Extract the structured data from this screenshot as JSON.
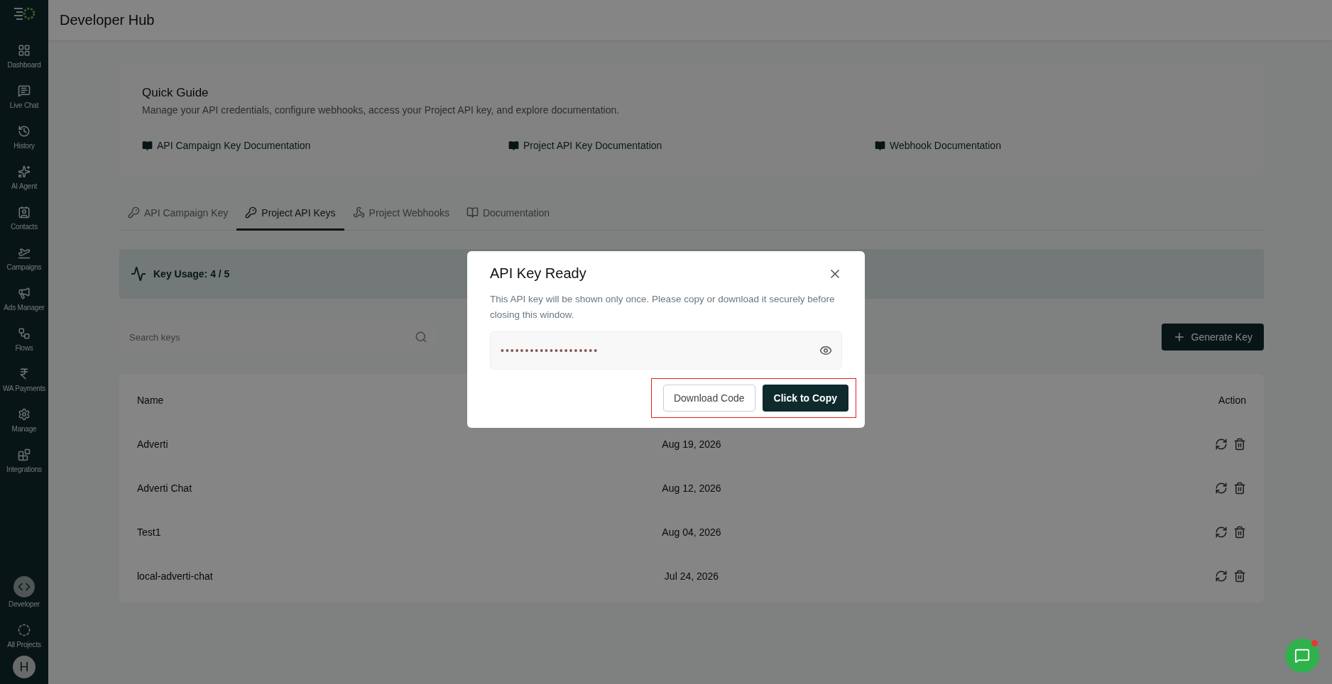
{
  "sidebar": {
    "items": [
      {
        "label": "Dashboard",
        "selected": false
      },
      {
        "label": "Live Chat",
        "selected": false
      },
      {
        "label": "History",
        "selected": false
      },
      {
        "label": "AI Agent",
        "selected": false
      },
      {
        "label": "Contacts",
        "selected": false
      },
      {
        "label": "Campaigns",
        "selected": false
      },
      {
        "label": "Ads Manager",
        "selected": false
      },
      {
        "label": "Flows",
        "selected": false
      },
      {
        "label": "WA Payments",
        "selected": false
      },
      {
        "label": "Manage",
        "selected": false
      },
      {
        "label": "Integrations",
        "selected": false
      }
    ],
    "bottom_items": [
      {
        "label": "Developer",
        "selected": true
      },
      {
        "label": "All Projects",
        "selected": false
      }
    ],
    "avatar": "H"
  },
  "header": {
    "title": "Developer Hub"
  },
  "quick_guide": {
    "title": "Quick Guide",
    "description": "Manage your API credentials, configure webhooks, access your Project API key, and explore documentation.",
    "links": [
      "API Campaign Key Documentation",
      "Project API Key Documentation",
      "Webhook Documentation"
    ]
  },
  "tabs": [
    {
      "label": "API Campaign Key",
      "selected": false
    },
    {
      "label": "Project API Keys",
      "selected": true
    },
    {
      "label": "Project Webhooks",
      "selected": false
    },
    {
      "label": "Documentation",
      "selected": false
    }
  ],
  "usage": {
    "label": "Key Usage: 4 / 5"
  },
  "search": {
    "placeholder": "Search keys"
  },
  "generate_button": "Generate Key",
  "table": {
    "columns": [
      "Name",
      "Action"
    ],
    "rows": [
      {
        "name": "Adverti",
        "date": "Aug 19, 2026"
      },
      {
        "name": "Adverti Chat",
        "date": "Aug 12, 2026"
      },
      {
        "name": "Test1",
        "date": "Aug 04, 2026"
      },
      {
        "name": "local-adverti-chat",
        "date": "Jul 24, 2026"
      }
    ]
  },
  "modal": {
    "title": "API Key Ready",
    "message": "This API key will be shown only once. Please copy or download it securely before closing this window.",
    "key_value": "••••••••••••••••••••",
    "download_button": "Download Code",
    "copy_button": "Click to Copy",
    "actions_highlighted": true
  },
  "chat_widget": {
    "unread": true
  }
}
